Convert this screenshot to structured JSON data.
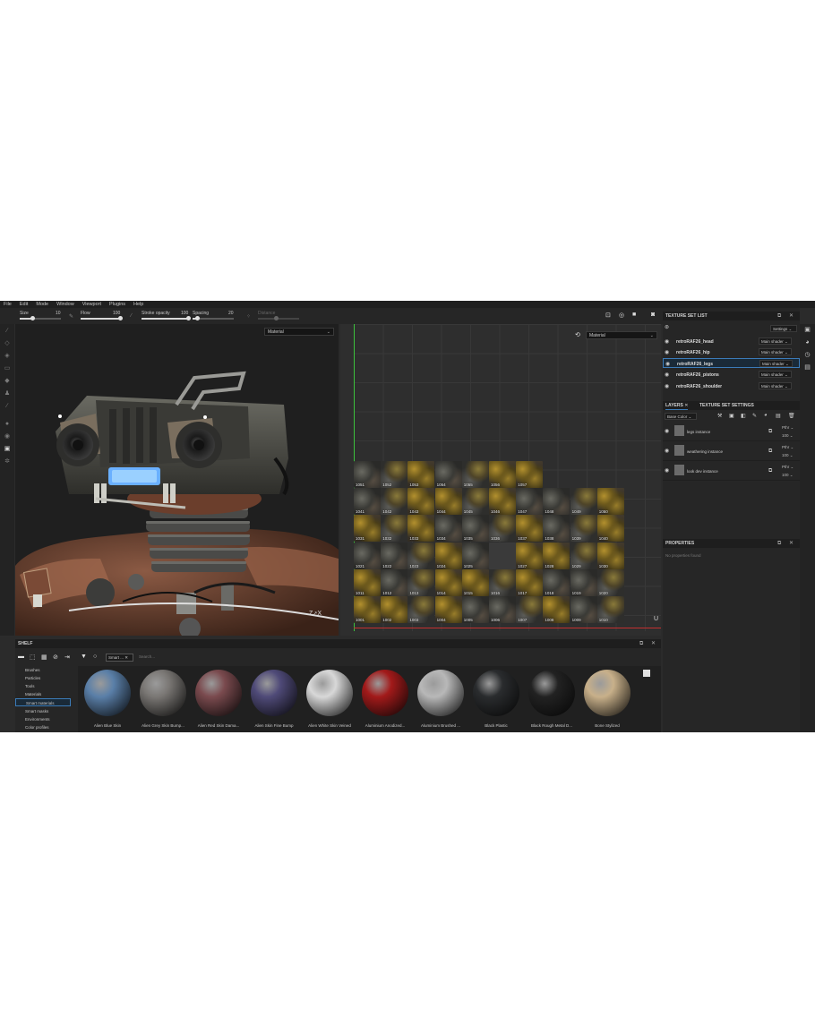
{
  "menu": [
    "File",
    "Edit",
    "Mode",
    "Window",
    "Viewport",
    "Plugins",
    "Help"
  ],
  "toolbar": {
    "size_label": "Size",
    "size_value": "10",
    "flow_label": "Flow",
    "flow_value": "100",
    "stroke_label": "Stroke opacity",
    "stroke_value": "100",
    "spacing_label": "Spacing",
    "spacing_value": "20",
    "distance_label": "Distance"
  },
  "viewport3d": {
    "dropdown": "Material"
  },
  "viewport2d": {
    "dropdown": "Material",
    "u_label": "U",
    "tiles": [
      [
        "1051",
        "1052",
        "1053",
        "1054",
        "1055",
        "1056",
        "1057"
      ],
      [
        "1041",
        "1042",
        "1043",
        "1044",
        "1045",
        "1046",
        "1047",
        "1048",
        "1049",
        "1050"
      ],
      [
        "1031",
        "1032",
        "1033",
        "1034",
        "1035",
        "1036",
        "1037",
        "1038",
        "1039",
        "1040"
      ],
      [
        "1021",
        "1022",
        "1023",
        "1024",
        "1025",
        "",
        "1027",
        "1028",
        "1029",
        "1030"
      ],
      [
        "1011",
        "1012",
        "1013",
        "1014",
        "1015",
        "1016",
        "1017",
        "1018",
        "1019",
        "1020"
      ],
      [
        "1001",
        "1002",
        "1003",
        "1004",
        "1005",
        "1006",
        "1007",
        "1008",
        "1009",
        "1010"
      ]
    ]
  },
  "texture_set_list": {
    "title": "TEXTURE SET LIST",
    "settings": "Settings",
    "rows": [
      {
        "name": "retroRAF26_head",
        "shader": "Main shader"
      },
      {
        "name": "retroRAF26_hip",
        "shader": "Main shader"
      },
      {
        "name": "retroRAF26_legs",
        "shader": "Main shader"
      },
      {
        "name": "retroRAF26_pistons",
        "shader": "Main shader"
      },
      {
        "name": "retroRAF26_shoulder",
        "shader": "Main shader"
      }
    ]
  },
  "layers": {
    "tab_layers": "LAYERS",
    "tab_tss": "TEXTURE SET SETTINGS",
    "channel": "Base Color",
    "rows": [
      {
        "name": "legs instance",
        "blend": "Pthr",
        "opacity": "100"
      },
      {
        "name": "weathering instance",
        "blend": "Pthr",
        "opacity": "100"
      },
      {
        "name": "look dev instance",
        "blend": "Pthr",
        "opacity": "100"
      }
    ]
  },
  "properties": {
    "title": "PROPERTIES",
    "empty": "No properties found"
  },
  "shelf": {
    "title": "SHELF",
    "filter_chip": "Smart ...",
    "search_placeholder": "Search...",
    "categories": [
      "Brushes",
      "Particles",
      "Tools",
      "Materials",
      "Smart materials",
      "Smart masks",
      "Environments",
      "Color profiles"
    ],
    "materials": [
      {
        "name": "Alien Blue Skin",
        "color": "#5a7fa8"
      },
      {
        "name": "Alien Grey Skin Bump...",
        "color": "#7a7774"
      },
      {
        "name": "Alien Red Skin Dama...",
        "color": "#7a4a4e"
      },
      {
        "name": "Alien Skin Fine Bump",
        "color": "#4f4a78"
      },
      {
        "name": "Alien White Skin Veined",
        "color": "#d8d8d8"
      },
      {
        "name": "Aluminium Anodized...",
        "color": "#a21a1a"
      },
      {
        "name": "Aluminium Brushed ...",
        "color": "#b8b8b8"
      },
      {
        "name": "Black Plastic",
        "color": "#2a2c2e"
      },
      {
        "name": "Black Rough Metal D...",
        "color": "#222222"
      },
      {
        "name": "Bone Stylized",
        "color": "#c8b08a"
      }
    ]
  }
}
